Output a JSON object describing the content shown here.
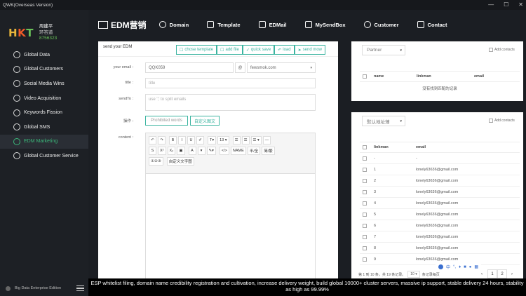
{
  "window": {
    "title": "QWK(Overseas Version)",
    "min": "—",
    "max": "☐",
    "close": "✕"
  },
  "brand": {
    "logo_h": "H",
    "logo_k": "K",
    "logo_t": "T",
    "name": "周建平",
    "role": "环答道",
    "id": "8756323"
  },
  "nav": [
    {
      "label": "Global Data",
      "icon": "globe-icon"
    },
    {
      "label": "Global Customers",
      "icon": "users-icon"
    },
    {
      "label": "Social Media Wins",
      "icon": "share-icon"
    },
    {
      "label": "Video Acquisition",
      "icon": "video-icon"
    },
    {
      "label": "Keywords Fission",
      "icon": "key-icon"
    },
    {
      "label": "Global SMS",
      "icon": "sms-icon"
    },
    {
      "label": "EDM Marketing",
      "icon": "mail-icon",
      "active": true
    },
    {
      "label": "Global Customer Service",
      "icon": "headset-icon"
    }
  ],
  "sidebar_footer": "Big Data Enterprise Edition",
  "topnav": {
    "logo": "EDM营销",
    "items": [
      "Domain",
      "Template",
      "EDMail",
      "MySendBox",
      "Customer",
      "Contact"
    ]
  },
  "edm": {
    "header": "send your EDM",
    "buttons": [
      "chose template",
      "add file",
      "quick save",
      "load",
      "send mow"
    ],
    "labels": {
      "email": "your email :",
      "title": "title :",
      "sendto": "sendTo :",
      "ops": "操作 :",
      "content": "content :"
    },
    "email_value": "QQK059",
    "at": "@",
    "domain_value": "fewsmok.com",
    "title_placeholder": "title",
    "sendto_placeholder": "use ';' to split emails",
    "prohibited_btn": "Prohibited words",
    "custom_btn": "自定义图文",
    "toolbar_row1": [
      "↶",
      "↷",
      "B",
      "I",
      "U",
      "✐",
      "T▾",
      "13 ▾",
      "☰",
      "☰",
      "☰ ▾",
      "—"
    ],
    "toolbar_row2": [
      "S",
      "X²",
      "X₂",
      "▣",
      "A",
      "▾",
      "✎▾",
      "</>",
      "NAME",
      "半/全",
      "简/繁"
    ],
    "toolbar_row3": [
      "①②③",
      "自定义文字图"
    ]
  },
  "partner": {
    "select": "Partner",
    "add": "Add contacts",
    "cols": [
      "name",
      "linkman",
      "email"
    ],
    "empty": "没有找到匹配的记录"
  },
  "contacts": {
    "select": "默认地址薄",
    "add": "Add contacts",
    "cols": [
      "linkman",
      "email"
    ],
    "rows": [
      {
        "linkman": "-",
        "email": "-"
      },
      {
        "linkman": "1",
        "email": "lonely63636@gmail.com"
      },
      {
        "linkman": "2",
        "email": "lonely63636@gmail.com"
      },
      {
        "linkman": "3",
        "email": "lonely63636@gmail.com"
      },
      {
        "linkman": "4",
        "email": "lonely63636@gmail.com"
      },
      {
        "linkman": "5",
        "email": "lonely63636@gmail.com"
      },
      {
        "linkman": "6",
        "email": "lonely63636@gmail.com"
      },
      {
        "linkman": "7",
        "email": "lonely63636@gmail.com"
      },
      {
        "linkman": "8",
        "email": "lonely63636@gmail.com"
      },
      {
        "linkman": "9",
        "email": "lonely63636@gmail.com"
      }
    ],
    "pager_text1": "第 1 到 10 条，共 19 条记录。",
    "page_size": "10 ▾",
    "pager_text2": "条记录每页",
    "pages": [
      "‹",
      "1",
      "2",
      "›"
    ]
  },
  "ime": {
    "label": "中"
  },
  "banner": "ESP whitelist filing, domain name credibility registration and cultivation, increase delivery weight, build global 10000+ cluster servers, massive ip support, stable delivery 24 hours, stability as high as 99.99%"
}
